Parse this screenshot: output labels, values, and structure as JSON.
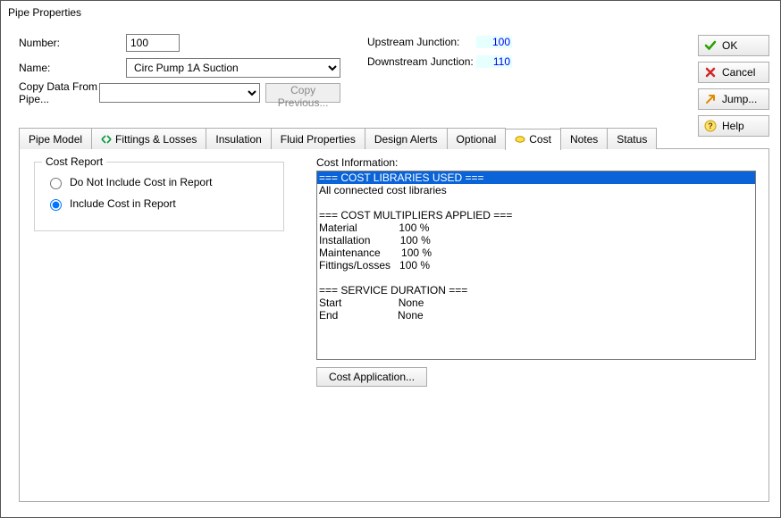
{
  "window": {
    "title": "Pipe Properties"
  },
  "fields": {
    "number_label": "Number:",
    "number_value": "100",
    "name_label": "Name:",
    "name_value": "Circ Pump 1A Suction",
    "copy_label": "Copy Data From Pipe...",
    "copy_prev_label": "Copy Previous..."
  },
  "junctions": {
    "upstream_label": "Upstream Junction:",
    "upstream_value": "100",
    "downstream_label": "Downstream Junction:",
    "downstream_value": "110"
  },
  "buttons": {
    "ok": "OK",
    "cancel": "Cancel",
    "jump": "Jump...",
    "help": "Help"
  },
  "tabs": {
    "pipe_model": "Pipe Model",
    "fittings": "Fittings & Losses",
    "insulation": "Insulation",
    "fluid": "Fluid Properties",
    "design": "Design Alerts",
    "optional": "Optional",
    "cost": "Cost",
    "notes": "Notes",
    "status": "Status"
  },
  "cost_tab": {
    "group_title": "Cost Report",
    "radio_no": "Do Not Include Cost in Report",
    "radio_yes": "Include Cost in Report",
    "selected_radio": "yes",
    "info_label": "Cost Information:",
    "lines": [
      "=== COST LIBRARIES USED ===",
      "All connected cost libraries",
      "",
      "=== COST MULTIPLIERS APPLIED ===",
      "Material              100 %",
      "Installation          100 %",
      "Maintenance       100 %",
      "Fittings/Losses   100 %",
      "",
      "=== SERVICE DURATION ===",
      "Start                   None",
      "End                    None"
    ],
    "cost_app_btn": "Cost Application..."
  }
}
